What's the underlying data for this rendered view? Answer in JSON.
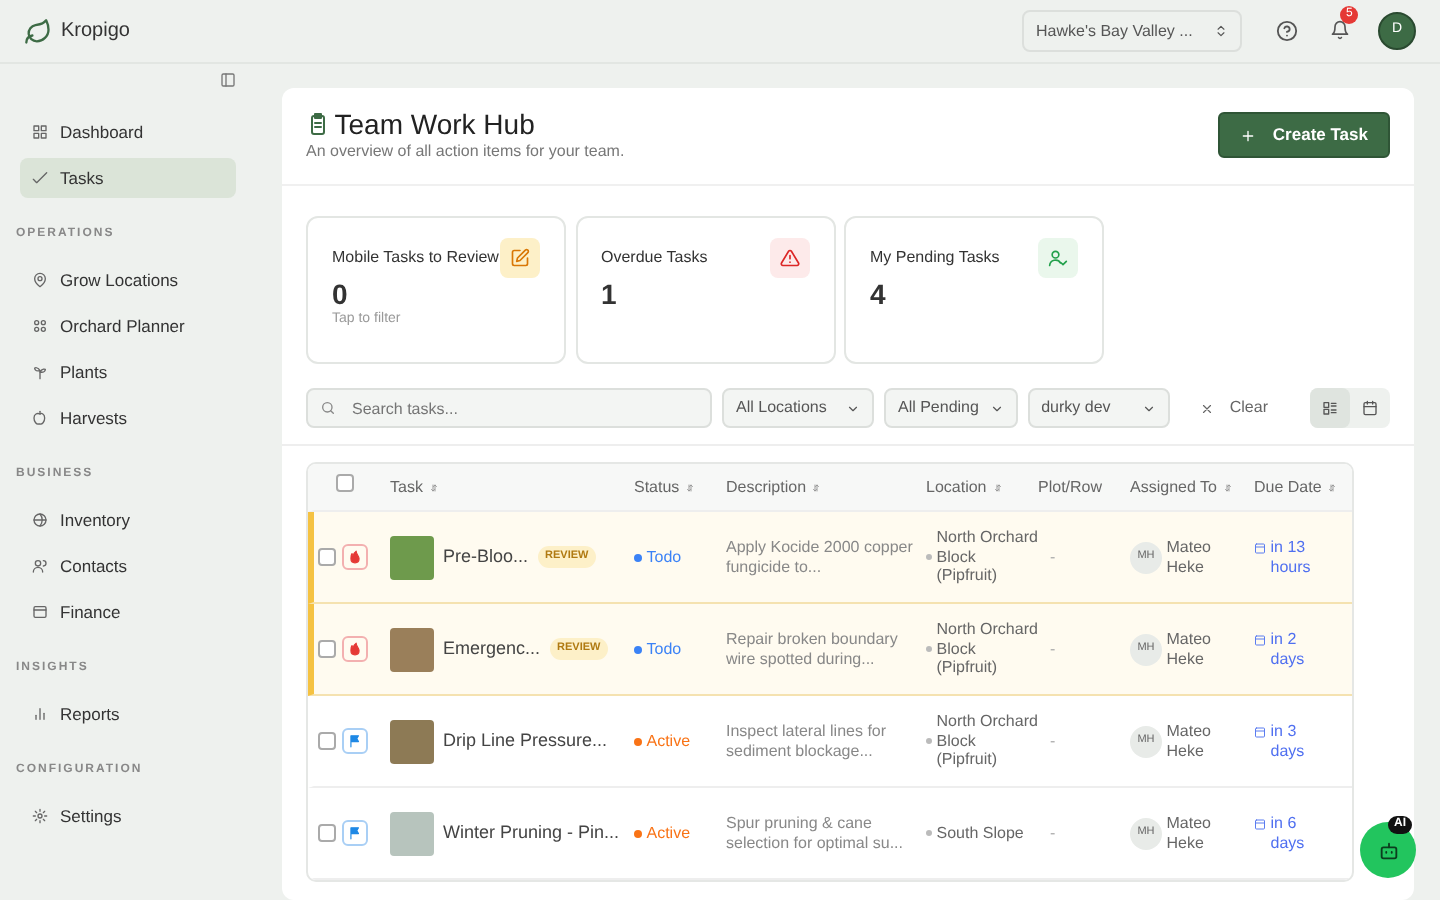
{
  "brand": {
    "name": "Kropigo"
  },
  "topbar": {
    "farm_select": "Hawke's Bay Valley ...",
    "notifications_count": "5",
    "avatar_initial": "D"
  },
  "sidebar": {
    "sections": [
      {
        "items": [
          {
            "label": "Dashboard",
            "selected": false
          },
          {
            "label": "Tasks",
            "selected": true
          }
        ]
      },
      {
        "title": "OPERATIONS",
        "items": [
          {
            "label": "Grow Locations",
            "selected": false
          },
          {
            "label": "Orchard Planner",
            "selected": false
          },
          {
            "label": "Plants",
            "selected": false
          },
          {
            "label": "Harvests",
            "selected": false
          }
        ]
      },
      {
        "title": "BUSINESS",
        "items": [
          {
            "label": "Inventory",
            "selected": false
          },
          {
            "label": "Contacts",
            "selected": false
          },
          {
            "label": "Finance",
            "selected": false
          }
        ]
      },
      {
        "title": "INSIGHTS",
        "items": [
          {
            "label": "Reports",
            "selected": false
          }
        ]
      },
      {
        "title": "CONFIGURATION",
        "items": [
          {
            "label": "Settings",
            "selected": false
          }
        ]
      }
    ]
  },
  "page": {
    "title": "Team Work Hub",
    "subtitle": "An overview of all action items for your team.",
    "create_button": "Create Task"
  },
  "stats": [
    {
      "kind": "review",
      "label": "Mobile Tasks to Review",
      "value": "0",
      "hint": "Tap to filter"
    },
    {
      "kind": "overdue",
      "label": "Overdue Tasks",
      "value": "1"
    },
    {
      "kind": "pending",
      "label": "My Pending Tasks",
      "value": "4"
    }
  ],
  "filters": {
    "search_placeholder": "Search tasks...",
    "selects": [
      "All Locations",
      "All Pending",
      "durky dev"
    ],
    "clear": "Clear",
    "views": [
      {
        "kind": "list",
        "selected": true
      },
      {
        "kind": "calendar",
        "selected": false
      }
    ]
  },
  "table": {
    "select_all_checked": false,
    "columns": [
      "Task",
      "Status",
      "Description",
      "Location",
      "Plot/Row",
      "Assigned To",
      "Due Date"
    ],
    "rows": [
      {
        "kind": "urgent",
        "title": "Pre-Bloo...",
        "review": true,
        "review_label": "REVIEW",
        "status": "Todo",
        "color": "#3b82f6",
        "description": "Apply Kocide 2000 copper fungicide to...",
        "location": "North Orchard Block (Pipfruit)",
        "plot": "-",
        "assignee_initials": "MH",
        "assignee": "Mateo Heke",
        "due": "in 13 hours",
        "checked": false
      },
      {
        "kind": "urgent",
        "title": "Emergenc...",
        "review": true,
        "review_label": "REVIEW",
        "status": "Todo",
        "color": "#3b82f6",
        "description": "Repair broken boundary wire spotted during...",
        "location": "North Orchard Block (Pipfruit)",
        "plot": "-",
        "assignee_initials": "MH",
        "assignee": "Mateo Heke",
        "due": "in 2 days",
        "checked": false
      },
      {
        "kind": "normal",
        "title": "Drip Line Pressure...",
        "review": false,
        "status": "Active",
        "color": "#f97316",
        "description": "Inspect lateral lines for sediment blockage...",
        "location": "North Orchard Block (Pipfruit)",
        "plot": "-",
        "assignee_initials": "MH",
        "assignee": "Mateo Heke",
        "due": "in 3 days",
        "checked": false
      },
      {
        "kind": "normal",
        "title": "Winter Pruning - Pin...",
        "review": false,
        "status": "Active",
        "color": "#f97316",
        "description": "Spur pruning & cane selection for optimal su...",
        "location": "South Slope",
        "plot": "-",
        "assignee_initials": "MH",
        "assignee": "Mateo Heke",
        "due": "in 6 days",
        "checked": false
      }
    ]
  },
  "assistant": {
    "badge": "AI"
  }
}
